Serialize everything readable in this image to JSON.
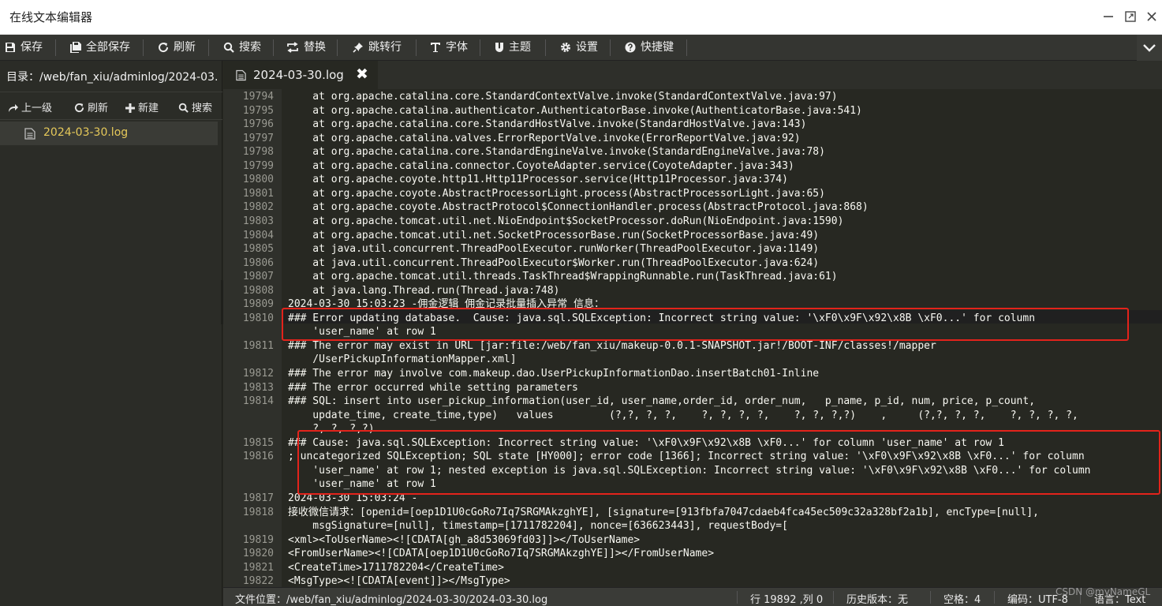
{
  "window": {
    "title": "在线文本编辑器"
  },
  "toolbar": {
    "save": "保存",
    "save_all": "全部保存",
    "refresh": "刷新",
    "search": "搜索",
    "replace": "替换",
    "goto_line": "跳转行",
    "font": "字体",
    "theme": "主题",
    "settings": "设置",
    "shortcuts": "快捷键"
  },
  "sidebar": {
    "directory": "目录：/web/fan_xiu/adminlog/2024-03...",
    "tools": {
      "up": "上一级",
      "refresh": "刷新",
      "new": "新建",
      "search": "搜索"
    },
    "files": [
      "2024-03-30.log"
    ]
  },
  "tabs": [
    {
      "label": "2024-03-30.log"
    }
  ],
  "editor": {
    "lines": [
      {
        "n": "19794",
        "text": "    at org.apache.catalina.core.StandardContextValve.invoke(StandardContextValve.java:97)"
      },
      {
        "n": "19795",
        "text": "    at org.apache.catalina.authenticator.AuthenticatorBase.invoke(AuthenticatorBase.java:541)"
      },
      {
        "n": "19796",
        "text": "    at org.apache.catalina.core.StandardHostValve.invoke(StandardHostValve.java:143)"
      },
      {
        "n": "19797",
        "text": "    at org.apache.catalina.valves.ErrorReportValve.invoke(ErrorReportValve.java:92)"
      },
      {
        "n": "19798",
        "text": "    at org.apache.catalina.core.StandardEngineValve.invoke(StandardEngineValve.java:78)"
      },
      {
        "n": "19799",
        "text": "    at org.apache.catalina.connector.CoyoteAdapter.service(CoyoteAdapter.java:343)"
      },
      {
        "n": "19800",
        "text": "    at org.apache.coyote.http11.Http11Processor.service(Http11Processor.java:374)"
      },
      {
        "n": "19801",
        "text": "    at org.apache.coyote.AbstractProcessorLight.process(AbstractProcessorLight.java:65)"
      },
      {
        "n": "19802",
        "text": "    at org.apache.coyote.AbstractProtocol$ConnectionHandler.process(AbstractProtocol.java:868)"
      },
      {
        "n": "19803",
        "text": "    at org.apache.tomcat.util.net.NioEndpoint$SocketProcessor.doRun(NioEndpoint.java:1590)"
      },
      {
        "n": "19804",
        "text": "    at org.apache.tomcat.util.net.SocketProcessorBase.run(SocketProcessorBase.java:49)"
      },
      {
        "n": "19805",
        "text": "    at java.util.concurrent.ThreadPoolExecutor.runWorker(ThreadPoolExecutor.java:1149)"
      },
      {
        "n": "19806",
        "text": "    at java.util.concurrent.ThreadPoolExecutor$Worker.run(ThreadPoolExecutor.java:624)"
      },
      {
        "n": "19807",
        "text": "    at org.apache.tomcat.util.threads.TaskThread$WrappingRunnable.run(TaskThread.java:61)"
      },
      {
        "n": "19808",
        "text": "    at java.lang.Thread.run(Thread.java:748)"
      },
      {
        "n": "19809",
        "text": "2024-03-30 15:03:23 -佣金逻辑 佣金记录批量插入异常 信息："
      },
      {
        "n": "19810",
        "text": "### Error updating database.  Cause: java.sql.SQLException: Incorrect string value: '\\xF0\\x9F\\x92\\x8B \\xF0...' for column"
      },
      {
        "n": "",
        "text": "    'user_name' at row 1"
      },
      {
        "n": "19811",
        "text": "### The error may exist in URL [jar:file:/web/fan_xiu/makeup-0.0.1-SNAPSHOT.jar!/BOOT-INF/classes!/mapper"
      },
      {
        "n": "",
        "text": "    /UserPickupInformationMapper.xml]"
      },
      {
        "n": "19812",
        "text": "### The error may involve com.makeup.dao.UserPickupInformationDao.insertBatch01-Inline"
      },
      {
        "n": "19813",
        "text": "### The error occurred while setting parameters"
      },
      {
        "n": "19814",
        "text": "### SQL: insert into user_pickup_information(user_id, user_name,order_id, order_num,   p_name, p_id, num, price, p_count,"
      },
      {
        "n": "",
        "text": "    update_time, create_time,type)   values         (?,?, ?, ?,    ?, ?, ?, ?,    ?, ?, ?,?)    ,     (?,?, ?, ?,    ?, ?, ?, ?,"
      },
      {
        "n": "",
        "text": "    ?, ?, ?,?)"
      },
      {
        "n": "19815",
        "text": "### Cause: java.sql.SQLException: Incorrect string value: '\\xF0\\x9F\\x92\\x8B \\xF0...' for column 'user_name' at row 1"
      },
      {
        "n": "19816",
        "text": "; uncategorized SQLException; SQL state [HY000]; error code [1366]; Incorrect string value: '\\xF0\\x9F\\x92\\x8B \\xF0...' for column"
      },
      {
        "n": "",
        "text": "    'user_name' at row 1; nested exception is java.sql.SQLException: Incorrect string value: '\\xF0\\x9F\\x92\\x8B \\xF0...' for column"
      },
      {
        "n": "",
        "text": "    'user_name' at row 1"
      },
      {
        "n": "19817",
        "text": "2024-03-30 15:03:24 -"
      },
      {
        "n": "19818",
        "text": "接收微信请求：[openid=[oep1D1U0cGoRo7Iq7SRGMAkzghYE], [signature=[913fbfa7047cdaeb4fca45ec509c32a328bf2a1b], encType=[null],"
      },
      {
        "n": "",
        "text": "    msgSignature=[null], timestamp=[1711782204], nonce=[636623443], requestBody=["
      },
      {
        "n": "19819",
        "text": "<xml><ToUserName><![CDATA[gh_a8d53069fd03]]></ToUserName>"
      },
      {
        "n": "19820",
        "text": "<FromUserName><![CDATA[oep1D1U0cGoRo7Iq7SRGMAkzghYE]]></FromUserName>"
      },
      {
        "n": "19821",
        "text": "<CreateTime>1711782204</CreateTime>"
      },
      {
        "n": "19822",
        "text": "<MsgType><![CDATA[event]]></MsgType>"
      }
    ]
  },
  "statusbar": {
    "file_path": "文件位置：/web/fan_xiu/adminlog/2024-03-30/2024-03-30.log",
    "cursor": "行 19892 ,列 0",
    "history": "历史版本：无",
    "indent": "空格：4",
    "encoding": "编码：UTF-8",
    "language": "语言：Text"
  },
  "watermark": "CSDN @myNameGL",
  "colors": {
    "editor_bg": "#272822",
    "toolbar_bg": "#343531",
    "highlight_box": "#e3231b",
    "active_file": "#e6c95a"
  }
}
